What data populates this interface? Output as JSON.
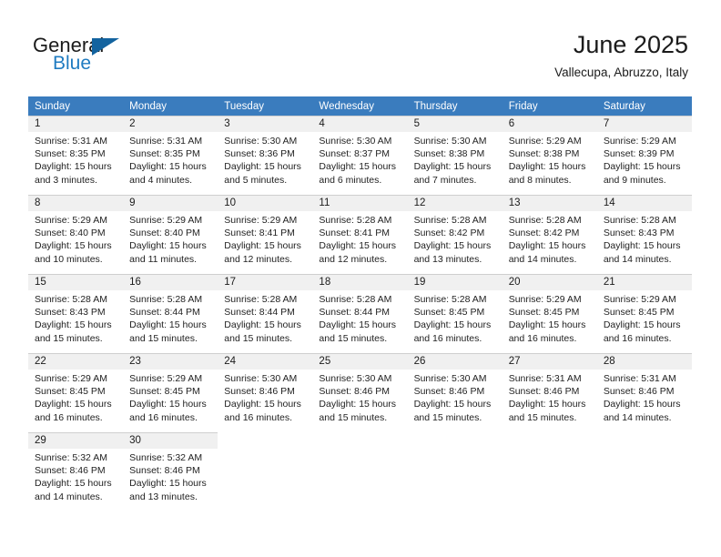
{
  "brand": {
    "name_part1": "General",
    "name_part2": "Blue",
    "accent_color": "#1f7bc1",
    "triangle_color": "#13639f"
  },
  "header": {
    "title": "June 2025",
    "location": "Vallecupa, Abruzzo, Italy"
  },
  "calendar": {
    "header_bg": "#3a7cbe",
    "daynum_bg": "#f0f0f0",
    "weekdays": [
      "Sunday",
      "Monday",
      "Tuesday",
      "Wednesday",
      "Thursday",
      "Friday",
      "Saturday"
    ],
    "weeks": [
      [
        {
          "day": "1",
          "sunrise": "Sunrise: 5:31 AM",
          "sunset": "Sunset: 8:35 PM",
          "daylight1": "Daylight: 15 hours",
          "daylight2": "and 3 minutes."
        },
        {
          "day": "2",
          "sunrise": "Sunrise: 5:31 AM",
          "sunset": "Sunset: 8:35 PM",
          "daylight1": "Daylight: 15 hours",
          "daylight2": "and 4 minutes."
        },
        {
          "day": "3",
          "sunrise": "Sunrise: 5:30 AM",
          "sunset": "Sunset: 8:36 PM",
          "daylight1": "Daylight: 15 hours",
          "daylight2": "and 5 minutes."
        },
        {
          "day": "4",
          "sunrise": "Sunrise: 5:30 AM",
          "sunset": "Sunset: 8:37 PM",
          "daylight1": "Daylight: 15 hours",
          "daylight2": "and 6 minutes."
        },
        {
          "day": "5",
          "sunrise": "Sunrise: 5:30 AM",
          "sunset": "Sunset: 8:38 PM",
          "daylight1": "Daylight: 15 hours",
          "daylight2": "and 7 minutes."
        },
        {
          "day": "6",
          "sunrise": "Sunrise: 5:29 AM",
          "sunset": "Sunset: 8:38 PM",
          "daylight1": "Daylight: 15 hours",
          "daylight2": "and 8 minutes."
        },
        {
          "day": "7",
          "sunrise": "Sunrise: 5:29 AM",
          "sunset": "Sunset: 8:39 PM",
          "daylight1": "Daylight: 15 hours",
          "daylight2": "and 9 minutes."
        }
      ],
      [
        {
          "day": "8",
          "sunrise": "Sunrise: 5:29 AM",
          "sunset": "Sunset: 8:40 PM",
          "daylight1": "Daylight: 15 hours",
          "daylight2": "and 10 minutes."
        },
        {
          "day": "9",
          "sunrise": "Sunrise: 5:29 AM",
          "sunset": "Sunset: 8:40 PM",
          "daylight1": "Daylight: 15 hours",
          "daylight2": "and 11 minutes."
        },
        {
          "day": "10",
          "sunrise": "Sunrise: 5:29 AM",
          "sunset": "Sunset: 8:41 PM",
          "daylight1": "Daylight: 15 hours",
          "daylight2": "and 12 minutes."
        },
        {
          "day": "11",
          "sunrise": "Sunrise: 5:28 AM",
          "sunset": "Sunset: 8:41 PM",
          "daylight1": "Daylight: 15 hours",
          "daylight2": "and 12 minutes."
        },
        {
          "day": "12",
          "sunrise": "Sunrise: 5:28 AM",
          "sunset": "Sunset: 8:42 PM",
          "daylight1": "Daylight: 15 hours",
          "daylight2": "and 13 minutes."
        },
        {
          "day": "13",
          "sunrise": "Sunrise: 5:28 AM",
          "sunset": "Sunset: 8:42 PM",
          "daylight1": "Daylight: 15 hours",
          "daylight2": "and 14 minutes."
        },
        {
          "day": "14",
          "sunrise": "Sunrise: 5:28 AM",
          "sunset": "Sunset: 8:43 PM",
          "daylight1": "Daylight: 15 hours",
          "daylight2": "and 14 minutes."
        }
      ],
      [
        {
          "day": "15",
          "sunrise": "Sunrise: 5:28 AM",
          "sunset": "Sunset: 8:43 PM",
          "daylight1": "Daylight: 15 hours",
          "daylight2": "and 15 minutes."
        },
        {
          "day": "16",
          "sunrise": "Sunrise: 5:28 AM",
          "sunset": "Sunset: 8:44 PM",
          "daylight1": "Daylight: 15 hours",
          "daylight2": "and 15 minutes."
        },
        {
          "day": "17",
          "sunrise": "Sunrise: 5:28 AM",
          "sunset": "Sunset: 8:44 PM",
          "daylight1": "Daylight: 15 hours",
          "daylight2": "and 15 minutes."
        },
        {
          "day": "18",
          "sunrise": "Sunrise: 5:28 AM",
          "sunset": "Sunset: 8:44 PM",
          "daylight1": "Daylight: 15 hours",
          "daylight2": "and 15 minutes."
        },
        {
          "day": "19",
          "sunrise": "Sunrise: 5:28 AM",
          "sunset": "Sunset: 8:45 PM",
          "daylight1": "Daylight: 15 hours",
          "daylight2": "and 16 minutes."
        },
        {
          "day": "20",
          "sunrise": "Sunrise: 5:29 AM",
          "sunset": "Sunset: 8:45 PM",
          "daylight1": "Daylight: 15 hours",
          "daylight2": "and 16 minutes."
        },
        {
          "day": "21",
          "sunrise": "Sunrise: 5:29 AM",
          "sunset": "Sunset: 8:45 PM",
          "daylight1": "Daylight: 15 hours",
          "daylight2": "and 16 minutes."
        }
      ],
      [
        {
          "day": "22",
          "sunrise": "Sunrise: 5:29 AM",
          "sunset": "Sunset: 8:45 PM",
          "daylight1": "Daylight: 15 hours",
          "daylight2": "and 16 minutes."
        },
        {
          "day": "23",
          "sunrise": "Sunrise: 5:29 AM",
          "sunset": "Sunset: 8:45 PM",
          "daylight1": "Daylight: 15 hours",
          "daylight2": "and 16 minutes."
        },
        {
          "day": "24",
          "sunrise": "Sunrise: 5:30 AM",
          "sunset": "Sunset: 8:46 PM",
          "daylight1": "Daylight: 15 hours",
          "daylight2": "and 16 minutes."
        },
        {
          "day": "25",
          "sunrise": "Sunrise: 5:30 AM",
          "sunset": "Sunset: 8:46 PM",
          "daylight1": "Daylight: 15 hours",
          "daylight2": "and 15 minutes."
        },
        {
          "day": "26",
          "sunrise": "Sunrise: 5:30 AM",
          "sunset": "Sunset: 8:46 PM",
          "daylight1": "Daylight: 15 hours",
          "daylight2": "and 15 minutes."
        },
        {
          "day": "27",
          "sunrise": "Sunrise: 5:31 AM",
          "sunset": "Sunset: 8:46 PM",
          "daylight1": "Daylight: 15 hours",
          "daylight2": "and 15 minutes."
        },
        {
          "day": "28",
          "sunrise": "Sunrise: 5:31 AM",
          "sunset": "Sunset: 8:46 PM",
          "daylight1": "Daylight: 15 hours",
          "daylight2": "and 14 minutes."
        }
      ],
      [
        {
          "day": "29",
          "sunrise": "Sunrise: 5:32 AM",
          "sunset": "Sunset: 8:46 PM",
          "daylight1": "Daylight: 15 hours",
          "daylight2": "and 14 minutes."
        },
        {
          "day": "30",
          "sunrise": "Sunrise: 5:32 AM",
          "sunset": "Sunset: 8:46 PM",
          "daylight1": "Daylight: 15 hours",
          "daylight2": "and 13 minutes."
        },
        {
          "day": "",
          "sunrise": "",
          "sunset": "",
          "daylight1": "",
          "daylight2": ""
        },
        {
          "day": "",
          "sunrise": "",
          "sunset": "",
          "daylight1": "",
          "daylight2": ""
        },
        {
          "day": "",
          "sunrise": "",
          "sunset": "",
          "daylight1": "",
          "daylight2": ""
        },
        {
          "day": "",
          "sunrise": "",
          "sunset": "",
          "daylight1": "",
          "daylight2": ""
        },
        {
          "day": "",
          "sunrise": "",
          "sunset": "",
          "daylight1": "",
          "daylight2": ""
        }
      ]
    ]
  }
}
